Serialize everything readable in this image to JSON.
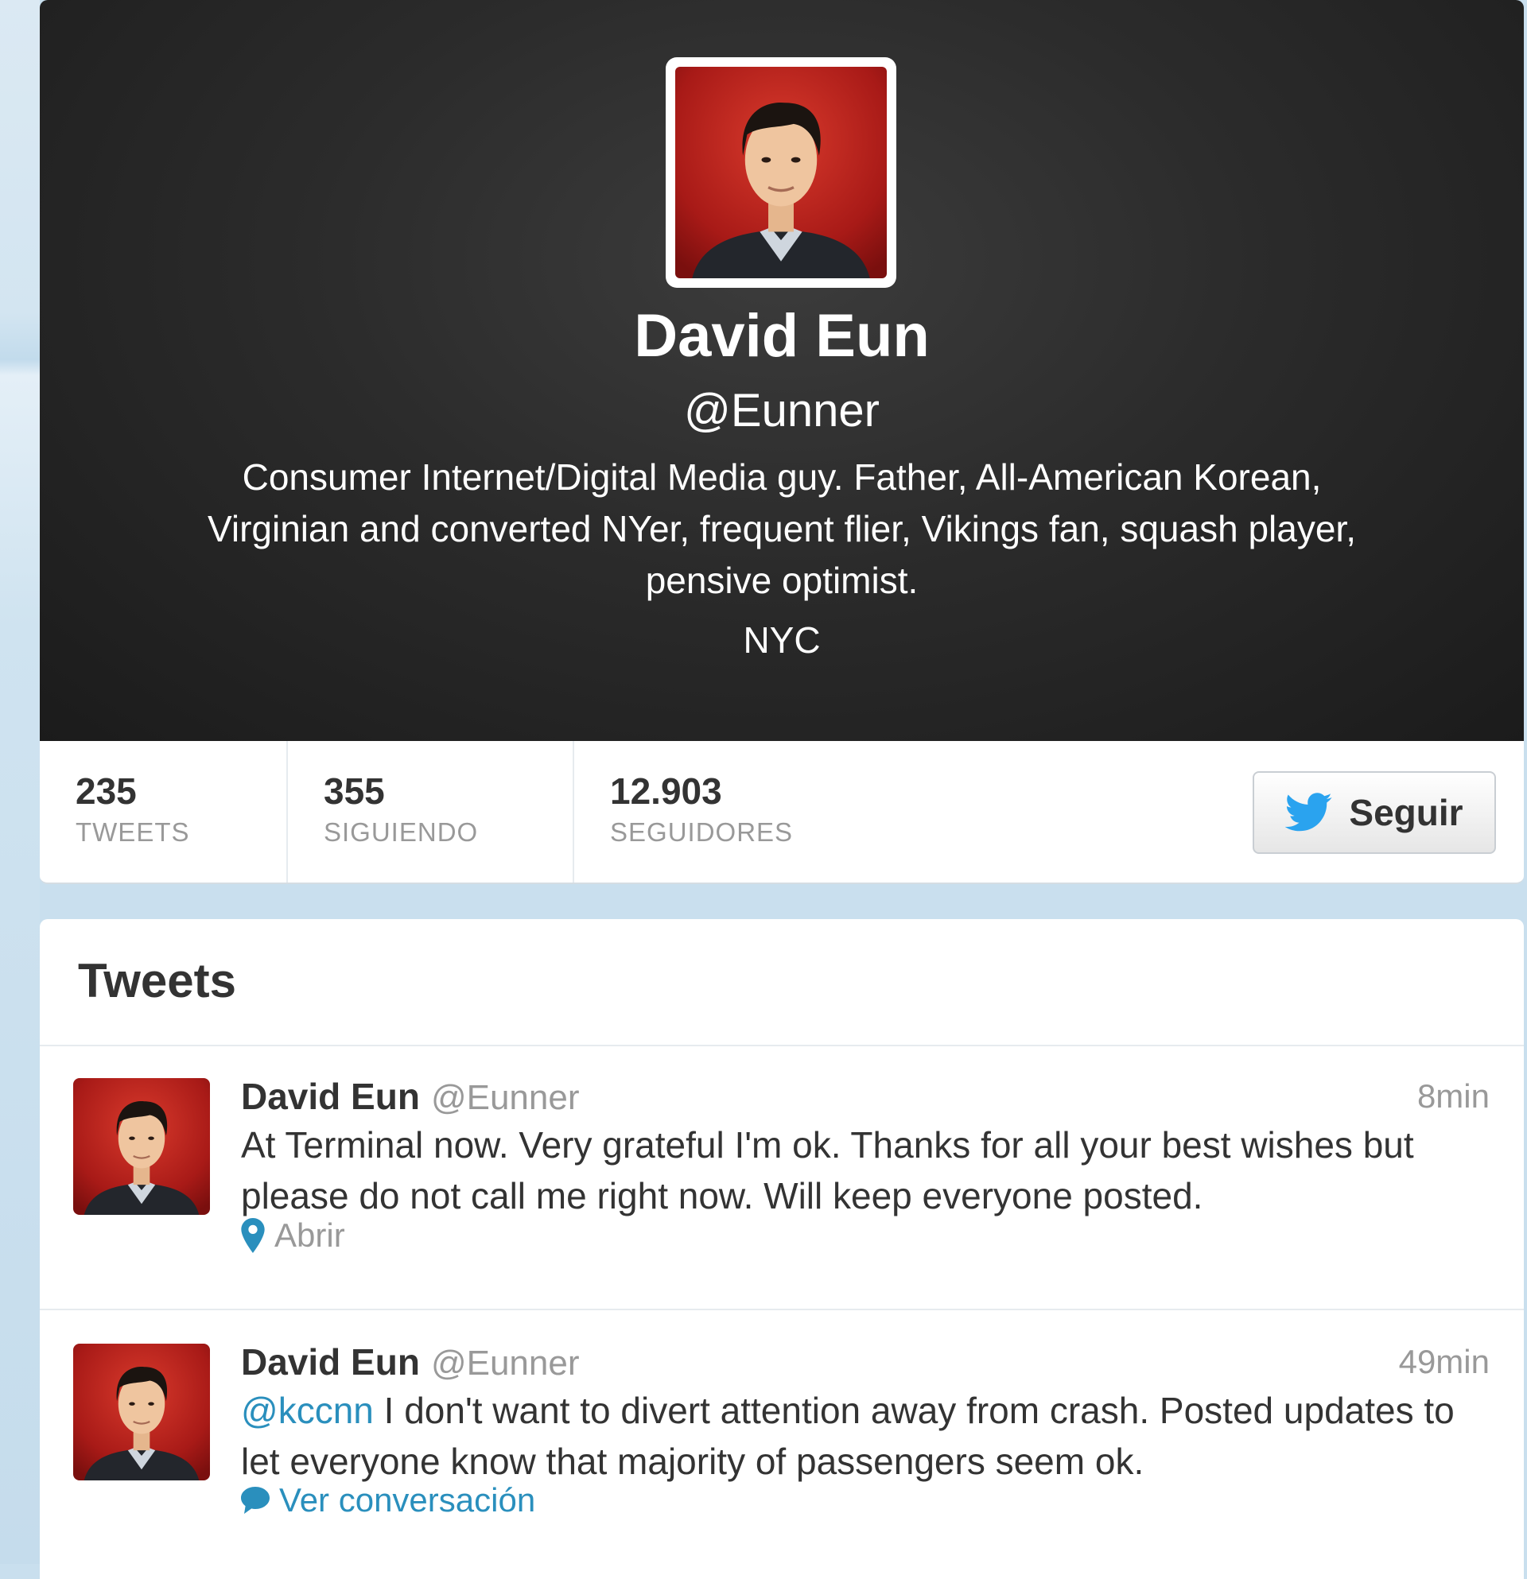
{
  "profile": {
    "name": "David Eun",
    "handle": "@Eunner",
    "bio": "Consumer Internet/Digital Media guy. Father, All-American Korean, Virginian and converted NYer, frequent flier, Vikings fan, squash player, pensive optimist.",
    "location": "NYC"
  },
  "stats": {
    "tweets": {
      "value": "235",
      "label": "TWEETS"
    },
    "following": {
      "value": "355",
      "label": "SIGUIENDO"
    },
    "followers": {
      "value": "12.903",
      "label": "SEGUIDORES"
    }
  },
  "follow_button": {
    "label": "Seguir",
    "icon": "twitter-bird-icon"
  },
  "timeline": {
    "heading": "Tweets",
    "tweets": [
      {
        "name": "David Eun",
        "handle": "@Eunner",
        "time": "8min",
        "text": "At Terminal now. Very grateful I'm ok. Thanks for all your best wishes but please do not call me right now. Will keep everyone posted.",
        "action": {
          "icon": "location-pin-icon",
          "label": "Abrir"
        }
      },
      {
        "name": "David Eun",
        "handle": "@Eunner",
        "time": "49min",
        "mention": "@kccnn",
        "text": " I don't want to divert attention away from crash. Posted updates to let everyone know that majority of passengers seem ok.",
        "action": {
          "icon": "speech-bubble-icon",
          "label": "Ver conversación"
        }
      }
    ]
  },
  "colors": {
    "header_bg": "#2b2b2b",
    "page_bg": "#c9dfee",
    "link": "#2a8fbd",
    "twitter_blue": "#2aa3ef",
    "avatar_red": "#b8231f"
  }
}
